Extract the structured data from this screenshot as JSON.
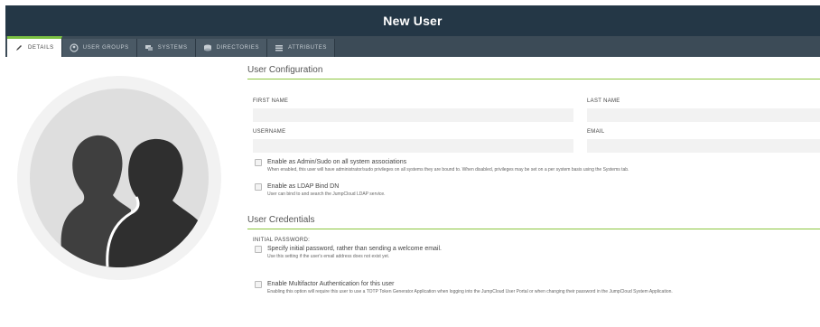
{
  "header": {
    "title": "New User"
  },
  "tabs": [
    {
      "label": "Details",
      "icon": "pencil-icon",
      "active": true
    },
    {
      "label": "User Groups",
      "icon": "user-groups-icon",
      "active": false
    },
    {
      "label": "Systems",
      "icon": "systems-icon",
      "active": false
    },
    {
      "label": "Directories",
      "icon": "directories-icon",
      "active": false
    },
    {
      "label": "Attributes",
      "icon": "attributes-icon",
      "active": false
    }
  ],
  "config": {
    "section_title": "User Configuration",
    "first_name_label": "FIRST NAME",
    "first_name_value": "",
    "last_name_label": "LAST NAME",
    "last_name_value": "",
    "username_label": "USERNAME",
    "username_value": "",
    "email_label": "EMAIL",
    "email_value": "",
    "admin_title": "Enable as Admin/Sudo on all system associations",
    "admin_sub": "When enabled, this user will have administrator/sudo privileges on all systems they are bound to. When disabled, privileges may be set on a per system basis using the Systems tab.",
    "ldap_title": "Enable as LDAP Bind DN",
    "ldap_sub": "User can bind to and search the JumpCloud LDAP service."
  },
  "credentials": {
    "section_title": "User Credentials",
    "initial_password_label": "INITIAL PASSWORD:",
    "specify_title": "Specify initial password, rather than sending a welcome email.",
    "specify_sub": "Use this setting if the user's email address does not exist yet.",
    "mfa_title": "Enable Multifactor Authentication for this user",
    "mfa_sub": "Enabling this option will require this user to use a TOTP Token Generator Application when logging into the JumpCloud User Portal or when changing their password in the JumpCloud System Application."
  },
  "colors": {
    "header_bg": "#243746",
    "tabbar_bg": "#3c4b57",
    "accent": "#8cc63f"
  }
}
